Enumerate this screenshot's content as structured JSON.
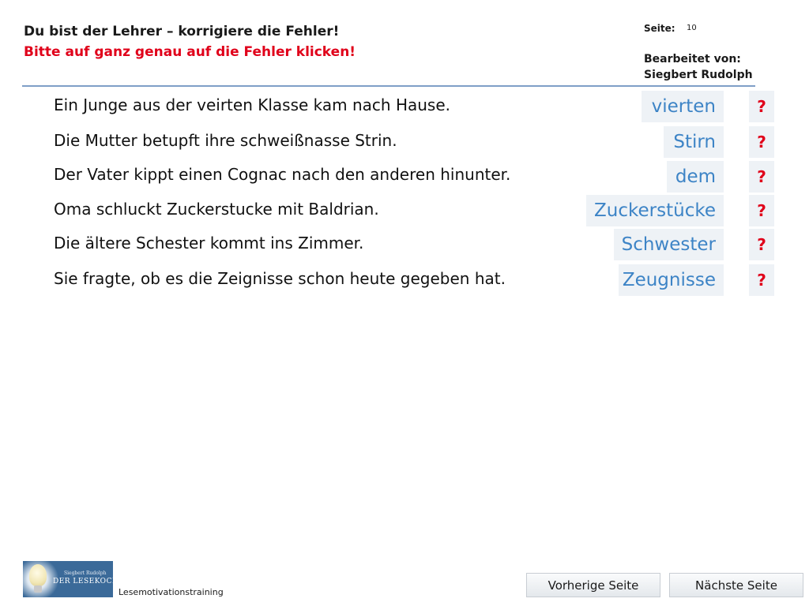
{
  "header": {
    "title": "Du bist der Lehrer – korrigiere die Fehler!",
    "subtitle": "Bitte auf ganz genau auf die Fehler klicken!",
    "page_label": "Seite:",
    "page_number": "10",
    "edited_label": "Bearbeitet  von:",
    "author": "Siegbert  Rudolph"
  },
  "rows": [
    {
      "sentence": "Ein Junge aus der veirten Klasse kam nach Hause.",
      "correction": "vierten",
      "hint": "?"
    },
    {
      "sentence": "Die Mutter betupft ihre schweißnasse Strin.",
      "correction": "Stirn",
      "hint": "?"
    },
    {
      "sentence": "Der Vater kippt einen Cognac nach den anderen hinunter.",
      "correction": "dem",
      "hint": "?"
    },
    {
      "sentence": "Oma schluckt Zuckerstucke mit Baldrian.",
      "correction": "Zuckerstücke",
      "hint": "?"
    },
    {
      "sentence": "Die ältere Schester kommt ins Zimmer.",
      "correction": "Schwester",
      "hint": "?"
    },
    {
      "sentence": "Sie fragte, ob es die Zeignisse schon heute gegeben hat.",
      "correction": "Zeugnisse",
      "hint": "?"
    }
  ],
  "footer": {
    "logo_line1": "Siegbert Rudolph",
    "logo_line2": "DER LESEKOCH",
    "label": "Lesemotivationstraining",
    "prev_button": "Vorherige Seite",
    "next_button": "Nächste Seite"
  },
  "colors": {
    "accent_red": "#e0001a",
    "answer_blue": "#3d84c6",
    "answer_bg": "#eef2f6",
    "rule": "#7f9fc7"
  }
}
